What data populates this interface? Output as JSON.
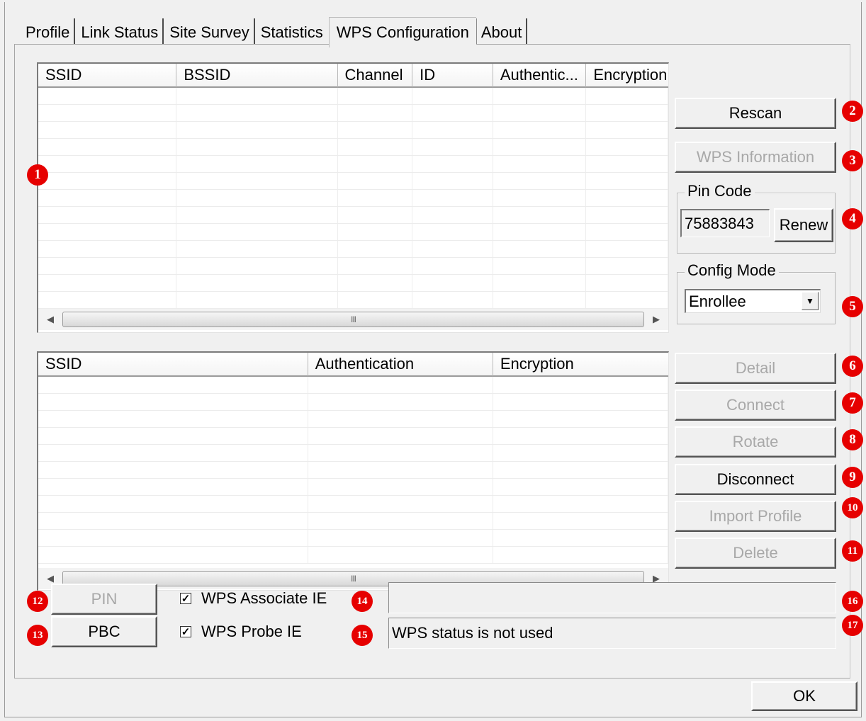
{
  "tabs": [
    "Profile",
    "Link Status",
    "Site Survey",
    "Statistics",
    "WPS Configuration",
    "About"
  ],
  "active_tab": "WPS Configuration",
  "ap_list": {
    "columns": [
      "SSID",
      "BSSID",
      "Channel",
      "ID",
      "Authentic...",
      "Encryption"
    ],
    "rows": []
  },
  "profile_list": {
    "columns": [
      "SSID",
      "Authentication",
      "Encryption"
    ],
    "rows": []
  },
  "scroll_grip": "III",
  "buttons": {
    "rescan": "Rescan",
    "wps_information": "WPS Information",
    "renew": "Renew",
    "detail": "Detail",
    "connect": "Connect",
    "rotate": "Rotate",
    "disconnect": "Disconnect",
    "import_profile": "Import Profile",
    "delete": "Delete",
    "pin": "PIN",
    "pbc": "PBC",
    "ok": "OK"
  },
  "pin_code": {
    "label": "Pin Code",
    "value": "75883843"
  },
  "config_mode": {
    "label": "Config Mode",
    "selected": "Enrollee"
  },
  "checkboxes": {
    "wps_associate_ie": {
      "label": "WPS Associate IE",
      "checked": true
    },
    "wps_probe_ie": {
      "label": "WPS Probe IE",
      "checked": true
    }
  },
  "status": {
    "line1": "",
    "line2": "WPS status is not used"
  },
  "markers": [
    "1",
    "2",
    "3",
    "4",
    "5",
    "6",
    "7",
    "8",
    "9",
    "10",
    "11",
    "12",
    "13",
    "14",
    "15",
    "16",
    "17"
  ],
  "colors": {
    "marker": "#e60000",
    "disabled_text": "#a8a8a8",
    "window_bg": "#f0f0f0"
  }
}
